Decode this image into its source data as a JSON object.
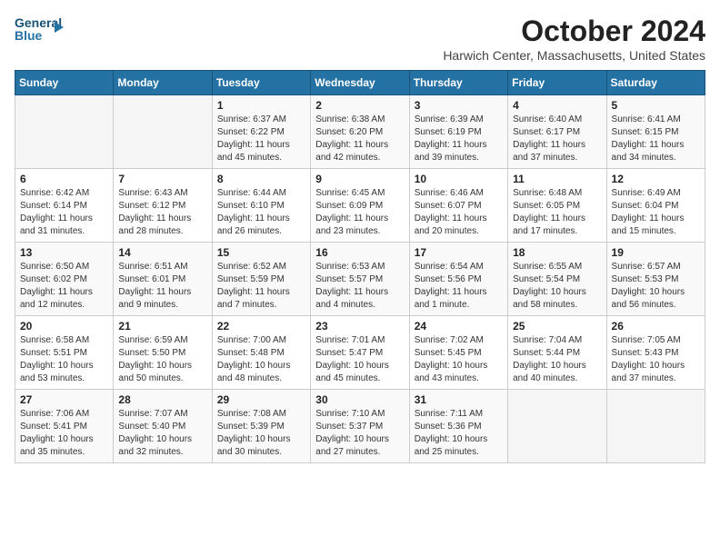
{
  "header": {
    "logo_line1": "General",
    "logo_line2": "Blue",
    "month": "October 2024",
    "location": "Harwich Center, Massachusetts, United States"
  },
  "weekdays": [
    "Sunday",
    "Monday",
    "Tuesday",
    "Wednesday",
    "Thursday",
    "Friday",
    "Saturday"
  ],
  "weeks": [
    [
      {
        "day": "",
        "detail": ""
      },
      {
        "day": "",
        "detail": ""
      },
      {
        "day": "1",
        "detail": "Sunrise: 6:37 AM\nSunset: 6:22 PM\nDaylight: 11 hours and 45 minutes."
      },
      {
        "day": "2",
        "detail": "Sunrise: 6:38 AM\nSunset: 6:20 PM\nDaylight: 11 hours and 42 minutes."
      },
      {
        "day": "3",
        "detail": "Sunrise: 6:39 AM\nSunset: 6:19 PM\nDaylight: 11 hours and 39 minutes."
      },
      {
        "day": "4",
        "detail": "Sunrise: 6:40 AM\nSunset: 6:17 PM\nDaylight: 11 hours and 37 minutes."
      },
      {
        "day": "5",
        "detail": "Sunrise: 6:41 AM\nSunset: 6:15 PM\nDaylight: 11 hours and 34 minutes."
      }
    ],
    [
      {
        "day": "6",
        "detail": "Sunrise: 6:42 AM\nSunset: 6:14 PM\nDaylight: 11 hours and 31 minutes."
      },
      {
        "day": "7",
        "detail": "Sunrise: 6:43 AM\nSunset: 6:12 PM\nDaylight: 11 hours and 28 minutes."
      },
      {
        "day": "8",
        "detail": "Sunrise: 6:44 AM\nSunset: 6:10 PM\nDaylight: 11 hours and 26 minutes."
      },
      {
        "day": "9",
        "detail": "Sunrise: 6:45 AM\nSunset: 6:09 PM\nDaylight: 11 hours and 23 minutes."
      },
      {
        "day": "10",
        "detail": "Sunrise: 6:46 AM\nSunset: 6:07 PM\nDaylight: 11 hours and 20 minutes."
      },
      {
        "day": "11",
        "detail": "Sunrise: 6:48 AM\nSunset: 6:05 PM\nDaylight: 11 hours and 17 minutes."
      },
      {
        "day": "12",
        "detail": "Sunrise: 6:49 AM\nSunset: 6:04 PM\nDaylight: 11 hours and 15 minutes."
      }
    ],
    [
      {
        "day": "13",
        "detail": "Sunrise: 6:50 AM\nSunset: 6:02 PM\nDaylight: 11 hours and 12 minutes."
      },
      {
        "day": "14",
        "detail": "Sunrise: 6:51 AM\nSunset: 6:01 PM\nDaylight: 11 hours and 9 minutes."
      },
      {
        "day": "15",
        "detail": "Sunrise: 6:52 AM\nSunset: 5:59 PM\nDaylight: 11 hours and 7 minutes."
      },
      {
        "day": "16",
        "detail": "Sunrise: 6:53 AM\nSunset: 5:57 PM\nDaylight: 11 hours and 4 minutes."
      },
      {
        "day": "17",
        "detail": "Sunrise: 6:54 AM\nSunset: 5:56 PM\nDaylight: 11 hours and 1 minute."
      },
      {
        "day": "18",
        "detail": "Sunrise: 6:55 AM\nSunset: 5:54 PM\nDaylight: 10 hours and 58 minutes."
      },
      {
        "day": "19",
        "detail": "Sunrise: 6:57 AM\nSunset: 5:53 PM\nDaylight: 10 hours and 56 minutes."
      }
    ],
    [
      {
        "day": "20",
        "detail": "Sunrise: 6:58 AM\nSunset: 5:51 PM\nDaylight: 10 hours and 53 minutes."
      },
      {
        "day": "21",
        "detail": "Sunrise: 6:59 AM\nSunset: 5:50 PM\nDaylight: 10 hours and 50 minutes."
      },
      {
        "day": "22",
        "detail": "Sunrise: 7:00 AM\nSunset: 5:48 PM\nDaylight: 10 hours and 48 minutes."
      },
      {
        "day": "23",
        "detail": "Sunrise: 7:01 AM\nSunset: 5:47 PM\nDaylight: 10 hours and 45 minutes."
      },
      {
        "day": "24",
        "detail": "Sunrise: 7:02 AM\nSunset: 5:45 PM\nDaylight: 10 hours and 43 minutes."
      },
      {
        "day": "25",
        "detail": "Sunrise: 7:04 AM\nSunset: 5:44 PM\nDaylight: 10 hours and 40 minutes."
      },
      {
        "day": "26",
        "detail": "Sunrise: 7:05 AM\nSunset: 5:43 PM\nDaylight: 10 hours and 37 minutes."
      }
    ],
    [
      {
        "day": "27",
        "detail": "Sunrise: 7:06 AM\nSunset: 5:41 PM\nDaylight: 10 hours and 35 minutes."
      },
      {
        "day": "28",
        "detail": "Sunrise: 7:07 AM\nSunset: 5:40 PM\nDaylight: 10 hours and 32 minutes."
      },
      {
        "day": "29",
        "detail": "Sunrise: 7:08 AM\nSunset: 5:39 PM\nDaylight: 10 hours and 30 minutes."
      },
      {
        "day": "30",
        "detail": "Sunrise: 7:10 AM\nSunset: 5:37 PM\nDaylight: 10 hours and 27 minutes."
      },
      {
        "day": "31",
        "detail": "Sunrise: 7:11 AM\nSunset: 5:36 PM\nDaylight: 10 hours and 25 minutes."
      },
      {
        "day": "",
        "detail": ""
      },
      {
        "day": "",
        "detail": ""
      }
    ]
  ]
}
